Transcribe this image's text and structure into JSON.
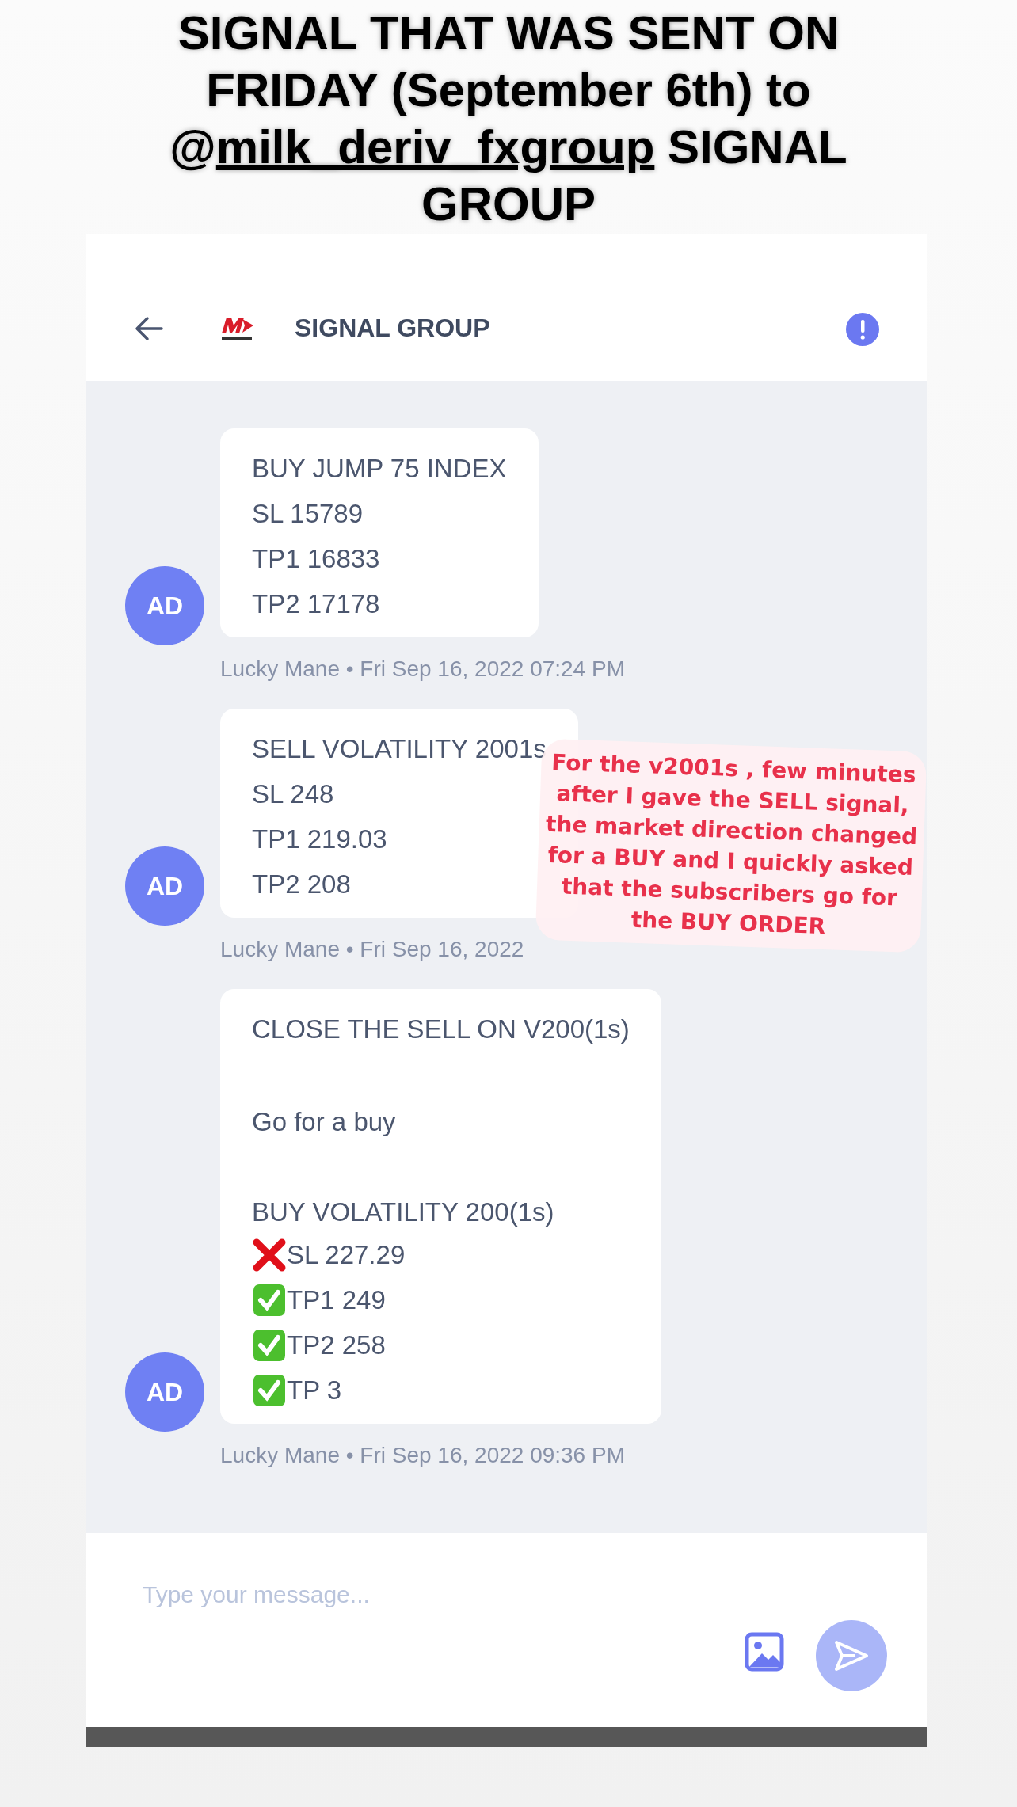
{
  "caption": {
    "prefix": "SIGNAL THAT WAS SENT ON FRIDAY (September 6th) to @",
    "link": "milk_deriv_fxgroup",
    "suffix": " SIGNAL GROUP"
  },
  "header": {
    "title": "SIGNAL GROUP"
  },
  "messages": [
    {
      "avatar": "AD",
      "lines": [
        {
          "kind": "plain",
          "text": "BUY JUMP 75 INDEX"
        },
        {
          "kind": "plain",
          "text": "SL 15789"
        },
        {
          "kind": "plain",
          "text": "TP1 16833"
        },
        {
          "kind": "plain",
          "text": "TP2 17178"
        }
      ],
      "meta": "Lucky Mane • Fri Sep 16, 2022 07:24 PM"
    },
    {
      "avatar": "AD",
      "lines": [
        {
          "kind": "plain",
          "text": "SELL VOLATILITY 2001s"
        },
        {
          "kind": "plain",
          "text": "SL 248"
        },
        {
          "kind": "plain",
          "text": "TP1 219.03"
        },
        {
          "kind": "plain",
          "text": "TP2 208"
        }
      ],
      "meta": "Lucky Mane • Fri Sep 16, 2022"
    },
    {
      "avatar": "AD",
      "lines": [
        {
          "kind": "plain",
          "text": "CLOSE THE SELL ON V200(1s)"
        },
        {
          "kind": "plain",
          "gap_before": true,
          "text": "Go for a buy"
        },
        {
          "kind": "plain",
          "gap_before": true,
          "text": "BUY VOLATILITY 200(1s)"
        },
        {
          "kind": "cross",
          "text": "SL 227.29"
        },
        {
          "kind": "check",
          "text": "TP1 249"
        },
        {
          "kind": "check",
          "text": "TP2 258"
        },
        {
          "kind": "check",
          "text": "TP 3"
        }
      ],
      "meta": "Lucky Mane • Fri Sep 16, 2022 09:36 PM"
    }
  ],
  "annotation": "For the v2001s , few minutes after I gave the SELL signal, the market direction changed for a BUY and I quickly asked that the subscribers go for the BUY ORDER",
  "composer": {
    "placeholder": "Type your message..."
  }
}
